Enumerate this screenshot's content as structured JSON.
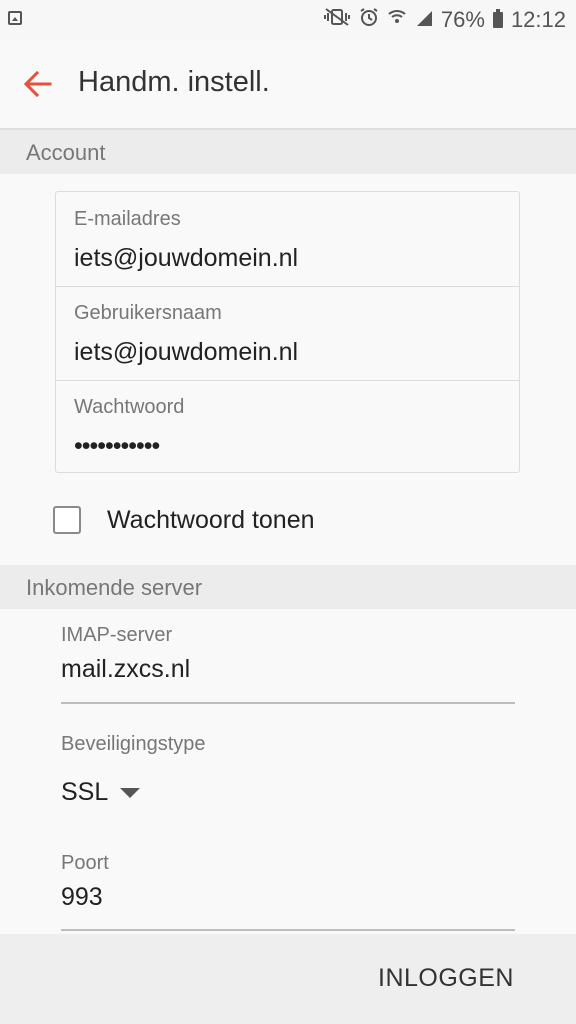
{
  "status_bar": {
    "battery_percent": "76%",
    "time": "12:12",
    "icons": [
      "image-icon",
      "mute-vibrate-icon",
      "alarm-icon",
      "wifi-icon",
      "signal-icon",
      "battery-icon"
    ]
  },
  "app_bar": {
    "title": "Handm. instell.",
    "back_icon": "arrow-back-icon",
    "accent_color": "#e8503a"
  },
  "account": {
    "section_title": "Account",
    "email": {
      "label": "E-mailadres",
      "value": "iets@jouwdomein.nl"
    },
    "username": {
      "label": "Gebruikersnaam",
      "value": "iets@jouwdomein.nl"
    },
    "password": {
      "label": "Wachtwoord",
      "value": "•••••••••••"
    },
    "show_password": {
      "label": "Wachtwoord tonen",
      "checked": false
    }
  },
  "incoming_server": {
    "section_title": "Inkomende server",
    "imap_server": {
      "label": "IMAP-server",
      "value": "mail.zxcs.nl"
    },
    "security_type": {
      "label": "Beveiligingstype",
      "value": "SSL"
    },
    "port": {
      "label": "Poort",
      "value": "993"
    }
  },
  "footer": {
    "login_label": "INLOGGEN"
  }
}
